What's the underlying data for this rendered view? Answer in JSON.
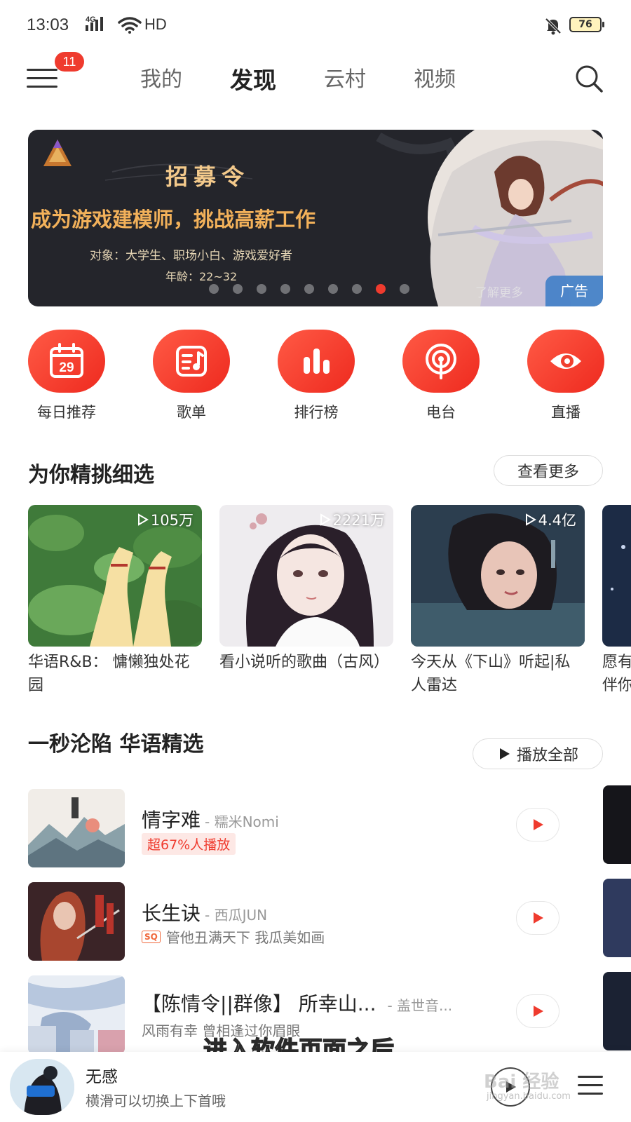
{
  "status_bar": {
    "time": "13:03",
    "network": "4G",
    "wifi_label": "HD",
    "battery": "76"
  },
  "header": {
    "menu_badge": "11",
    "tabs": [
      {
        "label": "我的",
        "active": false
      },
      {
        "label": "发现",
        "active": true
      },
      {
        "label": "云村",
        "active": false
      },
      {
        "label": "视频",
        "active": false
      }
    ]
  },
  "banner": {
    "title": "招募令",
    "headline": "成为游戏建模师，挑战高薪工作",
    "subtitle": "对象：大学生、职场小白、游戏爱好者",
    "age": "年龄：22~32",
    "learn_more": "了解更多",
    "ad_tag": "广告",
    "dot_count": 9,
    "active_dot": 8
  },
  "quick_entries": [
    {
      "label": "每日推荐",
      "icon": "calendar-icon",
      "date": "29"
    },
    {
      "label": "歌单",
      "icon": "playlist-icon"
    },
    {
      "label": "排行榜",
      "icon": "chart-icon"
    },
    {
      "label": "电台",
      "icon": "radio-icon"
    },
    {
      "label": "直播",
      "icon": "live-icon"
    }
  ],
  "picks": {
    "title": "为你精挑细选",
    "more_label": "查看更多",
    "playlists": [
      {
        "count": "105万",
        "name": "华语R&B： 慵懒独处花园"
      },
      {
        "count": "2221万",
        "name": "看小说听的歌曲（古风）"
      },
      {
        "count": "4.4亿",
        "name": "今天从《下山》听起|私人雷达"
      },
      {
        "count": "",
        "name": "愿有伴你"
      }
    ]
  },
  "section2": {
    "title": "一秒沦陷 华语精选",
    "play_all_label": "播放全部",
    "songs": [
      {
        "title": "情字难",
        "artist": "- 糯米Nomi",
        "tag": "超67%人播放",
        "meta": ""
      },
      {
        "title": "长生诀",
        "artist": "- 西瓜JUN",
        "tag": "SQ",
        "meta": "管他丑满天下 我瓜美如画"
      },
      {
        "title": "【陈情令||群像】 所幸山...",
        "artist": "- 盖世音...",
        "tag": "",
        "meta": "风雨有幸 曾相逢过你眉眼"
      }
    ]
  },
  "subtitle_overlay": "进入软件页面之后",
  "player": {
    "title": "无感",
    "subtitle": "横滑可以切换上下首哦"
  },
  "watermark": {
    "brand": "Bai 经验",
    "url": "jingyan.baidu.com"
  },
  "colors": {
    "accent": "#ef3b2e",
    "banner_bg": "#24252b",
    "headline": "#f2b15a"
  }
}
